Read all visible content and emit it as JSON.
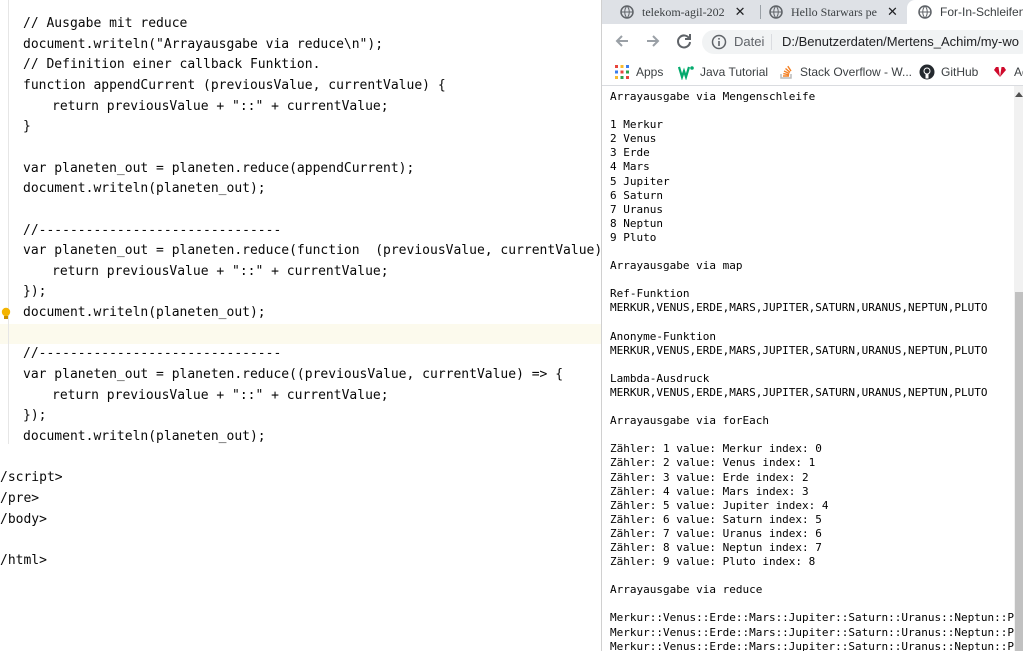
{
  "editor": {
    "lines": [
      {
        "type": "code",
        "text": "// Ausgabe mit reduce"
      },
      {
        "type": "code",
        "text": "document.writeln(\"Arrayausgabe via reduce\\n\");"
      },
      {
        "type": "code",
        "text": "// Definition einer callback Funktion."
      },
      {
        "type": "code",
        "text": "function appendCurrent (previousValue, currentValue) {"
      },
      {
        "type": "code1",
        "text": "return previousValue + \"::\" + currentValue;"
      },
      {
        "type": "code",
        "text": "}"
      },
      {
        "type": "blank",
        "text": ""
      },
      {
        "type": "code",
        "text": "var planeten_out = planeten.reduce(appendCurrent);"
      },
      {
        "type": "code",
        "text": "document.writeln(planeten_out);"
      },
      {
        "type": "blank",
        "text": ""
      },
      {
        "type": "code",
        "text": "//-------------------------------"
      },
      {
        "type": "code",
        "text": "var planeten_out = planeten.reduce(function  (previousValue, currentValue) {"
      },
      {
        "type": "code1",
        "text": "return previousValue + \"::\" + currentValue;"
      },
      {
        "type": "code",
        "text": "});"
      },
      {
        "type": "code",
        "text": "document.writeln(planeten_out);"
      },
      {
        "type": "blank",
        "text": ""
      },
      {
        "type": "code",
        "text": "//-------------------------------"
      },
      {
        "type": "code",
        "text": "var planeten_out = planeten.reduce((previousValue, currentValue) => {"
      },
      {
        "type": "code1",
        "text": "return previousValue + \"::\" + currentValue;"
      },
      {
        "type": "code",
        "text": "});"
      },
      {
        "type": "code",
        "text": "document.writeln(planeten_out);"
      },
      {
        "type": "blank",
        "text": ""
      },
      {
        "type": "tag",
        "text": "/script>"
      },
      {
        "type": "tag",
        "text": "/pre>"
      },
      {
        "type": "tag",
        "text": "/body>"
      },
      {
        "type": "blank",
        "text": ""
      },
      {
        "type": "tag",
        "text": "/html>"
      }
    ]
  },
  "browser": {
    "tabs": [
      {
        "title": "telekom-agil-202",
        "close": "✕",
        "active": false
      },
      {
        "title": "Hello Starwars pe",
        "close": "✕",
        "active": false
      },
      {
        "title": "For-In-Schleifen",
        "close": "",
        "active": true
      }
    ],
    "omnibox": {
      "scheme_label": "Datei",
      "url": "D:/Benutzerdaten/Mertens_Achim/my-wo"
    },
    "bookmarks": [
      {
        "label": "Apps",
        "icon": "apps-grid-icon"
      },
      {
        "label": "Java Tutorial",
        "icon": "w3-icon"
      },
      {
        "label": "Stack Overflow - W...",
        "icon": "stackoverflow-icon"
      },
      {
        "label": "GitHub",
        "icon": "github-icon"
      },
      {
        "label": "Ad",
        "icon": "huawei-icon"
      }
    ],
    "page_text": "Arrayausgabe via Mengenschleife\n\n1 Merkur\n2 Venus\n3 Erde\n4 Mars\n5 Jupiter\n6 Saturn\n7 Uranus\n8 Neptun\n9 Pluto\n\nArrayausgabe via map\n\nRef-Funktion\nMERKUR,VENUS,ERDE,MARS,JUPITER,SATURN,URANUS,NEPTUN,PLUTO\n\nAnonyme-Funktion\nMERKUR,VENUS,ERDE,MARS,JUPITER,SATURN,URANUS,NEPTUN,PLUTO\n\nLambda-Ausdruck\nMERKUR,VENUS,ERDE,MARS,JUPITER,SATURN,URANUS,NEPTUN,PLUTO\n\nArrayausgabe via forEach\n\nZähler: 1 value: Merkur index: 0\nZähler: 2 value: Venus index: 1\nZähler: 3 value: Erde index: 2\nZähler: 4 value: Mars index: 3\nZähler: 5 value: Jupiter index: 4\nZähler: 6 value: Saturn index: 5\nZähler: 7 value: Uranus index: 6\nZähler: 8 value: Neptun index: 7\nZähler: 9 value: Pluto index: 8\n\nArrayausgabe via reduce\n\nMerkur::Venus::Erde::Mars::Jupiter::Saturn::Uranus::Neptun::Pluto\nMerkur::Venus::Erde::Mars::Jupiter::Saturn::Uranus::Neptun::Pluto\nMerkur::Venus::Erde::Mars::Jupiter::Saturn::Uranus::Neptun::Pluto"
  }
}
